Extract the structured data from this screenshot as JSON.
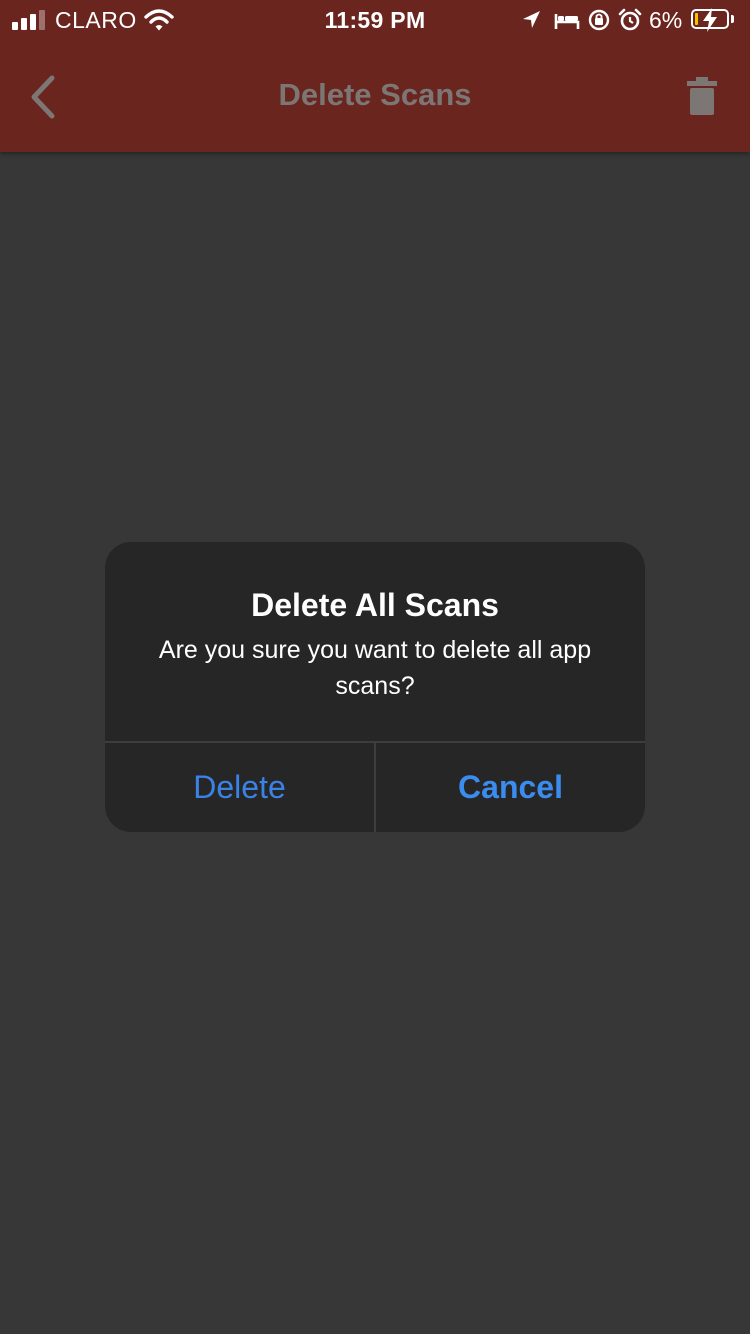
{
  "status_bar": {
    "carrier": "CLARO",
    "time": "11:59 PM",
    "battery_percent": "6%",
    "battery_level": 0.06,
    "icons": [
      "cellular-signal-icon",
      "wifi-icon",
      "location-arrow-icon",
      "bed-icon",
      "orientation-lock-icon",
      "alarm-icon",
      "battery-charging-icon"
    ]
  },
  "header": {
    "title": "Delete Scans",
    "back_icon": "chevron-left-icon",
    "action_icon": "trash-icon"
  },
  "dialog": {
    "title": "Delete All Scans",
    "message": "Are you sure you want to delete all app scans?",
    "buttons": {
      "delete": "Delete",
      "cancel": "Cancel"
    }
  },
  "colors": {
    "header_background": "#6a251f",
    "page_background": "#373737",
    "dialog_background": "#262626",
    "button_text": "#3b8cf0"
  }
}
